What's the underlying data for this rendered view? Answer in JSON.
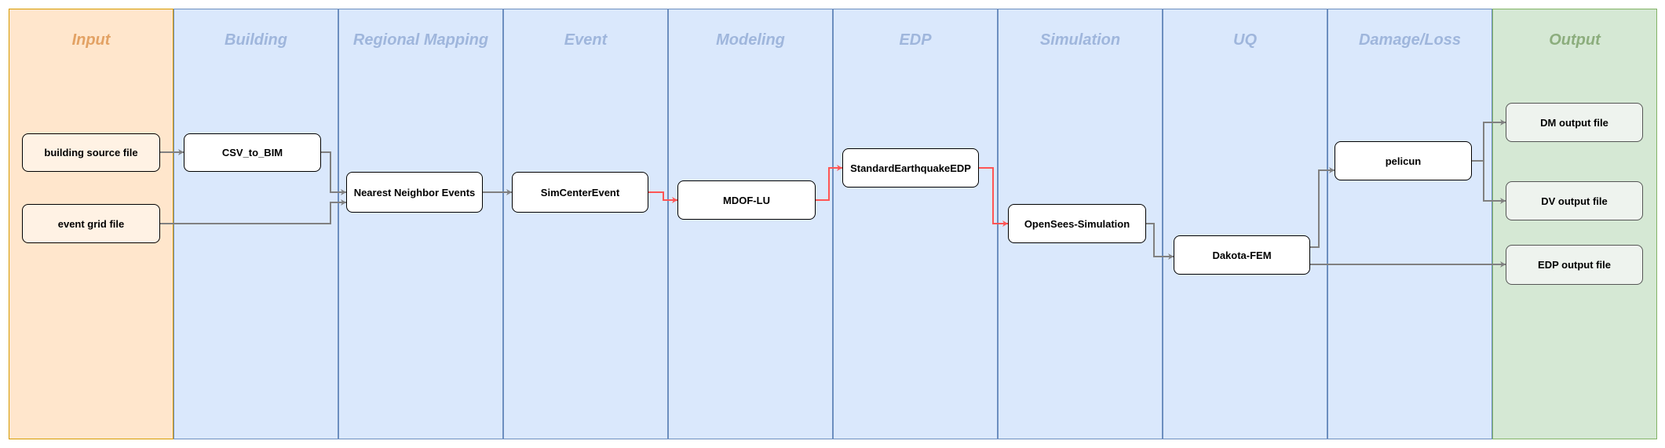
{
  "lanes": [
    {
      "title": "Input",
      "kind": "input"
    },
    {
      "title": "Building",
      "kind": "stage"
    },
    {
      "title": "Regional Mapping",
      "kind": "stage"
    },
    {
      "title": "Event",
      "kind": "stage"
    },
    {
      "title": "Modeling",
      "kind": "stage"
    },
    {
      "title": "EDP",
      "kind": "stage"
    },
    {
      "title": "Simulation",
      "kind": "stage"
    },
    {
      "title": "UQ",
      "kind": "stage"
    },
    {
      "title": "Damage/Loss",
      "kind": "stage"
    },
    {
      "title": "Output",
      "kind": "output"
    }
  ],
  "nodes": {
    "building_source_file": "building source file",
    "event_grid_file": "event grid file",
    "csv_to_bim": "CSV_to_BIM",
    "nearest_neighbor": "Nearest Neighbor Events",
    "simcenter_event": "SimCenterEvent",
    "mdof_lu": "MDOF-LU",
    "standard_edp": "StandardEarthquakeEDP",
    "opensees": "OpenSees-Simulation",
    "dakota": "Dakota-FEM",
    "pelicun": "pelicun",
    "dm_output": "DM output file",
    "dv_output": "DV output file",
    "edp_output": "EDP output file"
  },
  "edges": [
    {
      "from": "building_source_file",
      "to": "csv_to_bim",
      "color": "#808080"
    },
    {
      "from": "csv_to_bim",
      "to": "nearest_neighbor",
      "color": "#808080"
    },
    {
      "from": "event_grid_file",
      "to": "nearest_neighbor",
      "color": "#808080"
    },
    {
      "from": "nearest_neighbor",
      "to": "simcenter_event",
      "color": "#808080"
    },
    {
      "from": "simcenter_event",
      "to": "mdof_lu",
      "color": "#ff5555"
    },
    {
      "from": "mdof_lu",
      "to": "standard_edp",
      "color": "#ff5555"
    },
    {
      "from": "standard_edp",
      "to": "opensees",
      "color": "#ff5555"
    },
    {
      "from": "opensees",
      "to": "dakota",
      "color": "#808080"
    },
    {
      "from": "dakota",
      "to": "pelicun",
      "color": "#808080"
    },
    {
      "from": "dakota",
      "to": "edp_output",
      "color": "#808080"
    },
    {
      "from": "pelicun",
      "to": "dm_output",
      "color": "#808080"
    },
    {
      "from": "pelicun",
      "to": "dv_output",
      "color": "#808080"
    }
  ],
  "colors": {
    "input_lane": "#ffe6cc",
    "stage_lane": "#dae8fc",
    "output_lane": "#d5e8d4",
    "highlight_edge": "#ff5555",
    "normal_edge": "#808080"
  }
}
